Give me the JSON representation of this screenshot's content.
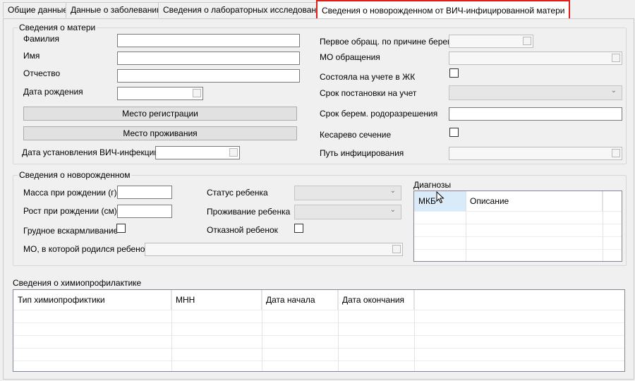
{
  "tabs": [
    {
      "label": "Общие данные"
    },
    {
      "label": "Данные о заболевании"
    },
    {
      "label": "Сведения о лабораторных исследованиях"
    },
    {
      "label": "Сведения о новорожденном от ВИЧ-инфицированной матери"
    }
  ],
  "mother": {
    "legend": "Сведения о матери",
    "surname_label": "Фамилия",
    "surname_value": "",
    "name_label": "Имя",
    "name_value": "",
    "patronymic_label": "Отчество",
    "patronymic_value": "",
    "birthdate_label": "Дата рождения",
    "reg_place_button": "Место регистрации",
    "residence_button": "Место проживания",
    "hiv_date_label": "Дата установления ВИЧ-инфекции",
    "first_visit_label": "Первое обращ. по причине берем.",
    "mo_visit_label": "МО обращения",
    "registered_label": "Состояла на учете в ЖК",
    "reg_term_label": "Срок постановки на учет",
    "reg_term_value": "",
    "delivery_term_label": "Срок берем. родоразрешения",
    "delivery_term_value": "",
    "cesarean_label": "Кесарево сечение",
    "infection_path_label": "Путь инфицирования"
  },
  "newborn": {
    "legend": "Сведения о новорожденном",
    "weight_label": "Масса при рождении (г)",
    "weight_value": "",
    "height_label": "Рост при рождении (см)",
    "height_value": "",
    "breastfeeding_label": "Грудное вскармливание",
    "status_label": "Статус ребенка",
    "status_value": "",
    "living_label": "Проживание ребенка",
    "living_value": "",
    "abandoned_label": "Отказной ребенок",
    "birth_mo_label": "МО, в которой родился ребенок"
  },
  "diagnoses": {
    "label": "Диагнозы",
    "columns": [
      "МКБ",
      "Описание"
    ]
  },
  "chemo": {
    "label": "Сведения о химиопрофилактике",
    "columns": [
      "Тип химиопрофиктики",
      "МНН",
      "Дата начала",
      "Дата окончания"
    ]
  }
}
